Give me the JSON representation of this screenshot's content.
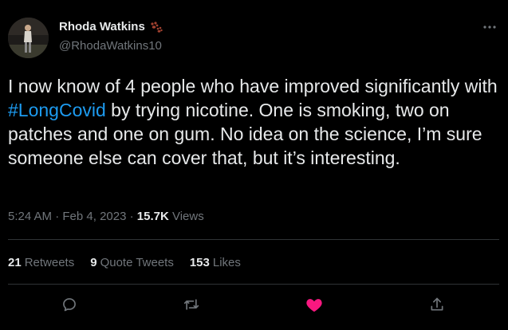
{
  "author": {
    "name": "Rhoda Watkins",
    "handle": "@RhodaWatkins10",
    "badge_icon": "paw-prints-icon",
    "badge_color": "#a1412f"
  },
  "tweet": {
    "text_before": "I now know of 4 people who have improved significantly with ",
    "hashtag": "#LongCovid",
    "text_after": " by trying nicotine. One is smoking, two on patches and one on gum. No idea on the science, I’m sure someone else can cover that, but it’s interesting."
  },
  "meta": {
    "time": "5:24 AM",
    "separator1": " · ",
    "date": "Feb 4, 2023",
    "separator2": " · ",
    "views_count": "15.7K",
    "views_label": " Views"
  },
  "stats": {
    "retweets_count": "21",
    "retweets_label": "Retweets",
    "quotes_count": "9",
    "quotes_label": "Quote Tweets",
    "likes_count": "153",
    "likes_label": "Likes"
  },
  "actions": {
    "reply_icon": "reply-icon",
    "retweet_icon": "retweet-icon",
    "like_icon": "heart-icon",
    "share_icon": "share-icon",
    "more_icon": "more-icon",
    "like_active": true,
    "like_color": "#f91880",
    "icon_color": "#71767b"
  },
  "colors": {
    "background": "#000000",
    "text": "#e7e9ea",
    "secondary": "#71767b",
    "link": "#1d9bf0",
    "divider": "#2f3336"
  }
}
